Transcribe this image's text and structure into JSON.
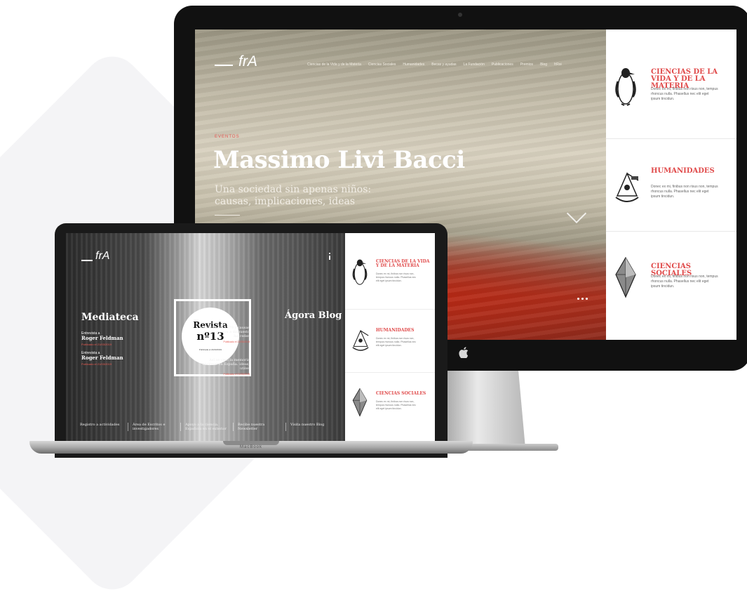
{
  "imac": {
    "logo": "frA",
    "nav": [
      "Ciencias de la Vida y de la Materia",
      "Ciencias Sociales",
      "Humanidades",
      "Becas y ayudas",
      "La Fundación",
      "Publicaciones",
      "Premios",
      "Blog",
      "frRoi"
    ],
    "hero": {
      "tag": "EVENTOS",
      "title": "Massimo Livi Bacci",
      "subtitle": "Una sociedad sin apenas niños: causas, implicaciones, ideas"
    },
    "cards": [
      {
        "title": "CIENCIAS DE LA VIDA Y DE LA MATERIA",
        "body": "Donec ex mi, finibus non risus non, tempus rhoncus nulla. Phasellus nec elit eget ipsum tincidun.",
        "icon": "penguin-icon"
      },
      {
        "title": "HUMANIDADES",
        "body": "Donec ex mi, finibus non risus non, tempus rhoncus nulla. Phasellus nec elit eget ipsum tincidun.",
        "icon": "sextant-icon"
      },
      {
        "title": "CIENCIAS SOCIALES",
        "body": "Donec ex mi, finibus non risus non, tempus rhoncus nulla. Phasellus nec elit eget ipsum tincidun.",
        "icon": "crystal-icon"
      }
    ]
  },
  "macbook": {
    "logo": "frA",
    "label": "MacBook",
    "mediateca": {
      "title": "Mediateca",
      "items": [
        {
          "kicker": "Entrevista a",
          "name": "Roger Feldman",
          "meta": "Publicado el 21/03/2019"
        },
        {
          "kicker": "Entrevista a",
          "name": "Roger Feldman",
          "meta": "Publicado el 21/03/2019"
        }
      ]
    },
    "revista": {
      "line1": "Revista",
      "line2": "nº13",
      "meta": "Publicada el 21/03/2019"
    },
    "blog": {
      "title": "Ágora Blog",
      "items": [
        {
          "text": "Lecturas del 1979 y causas de una guerra a dispuesto las redes",
          "meta": "Publicado el 21/03/2019"
        },
        {
          "text": "Así se creó la memoria nacional en España. ideas, utiles",
          "meta": "Publicado el 21/03/2019"
        }
      ]
    },
    "footer": [
      "Registro a actividades",
      "Área de Escritos e investigadores",
      "Apoyo a la ciencia. Española en el exterior",
      "Recibe nuestra Newsletter",
      "Visita nuestro Blog"
    ],
    "cards": [
      {
        "title": "CIENCIAS DE LA VIDA Y DE LA MATERIA",
        "body": "Donec ex mi, finibus non risus non, tempus rhoncus nulla. Phasellus nec elit eget ipsum tincidun.",
        "icon": "penguin-icon"
      },
      {
        "title": "HUMANIDADES",
        "body": "Donec ex mi, finibus non risus non, tempus rhoncus nulla. Phasellus nec elit eget ipsum tincidun.",
        "icon": "sextant-icon"
      },
      {
        "title": "CIENCIAS SOCIALES",
        "body": "Donec ex mi, finibus non risus non, tempus rhoncus nulla. Phasellus nec elit eget ipsum tincidun.",
        "icon": "crystal-icon"
      }
    ]
  },
  "colors": {
    "accent": "#e04a4a",
    "hero_red": "#a73220",
    "device_dark": "#111111"
  }
}
